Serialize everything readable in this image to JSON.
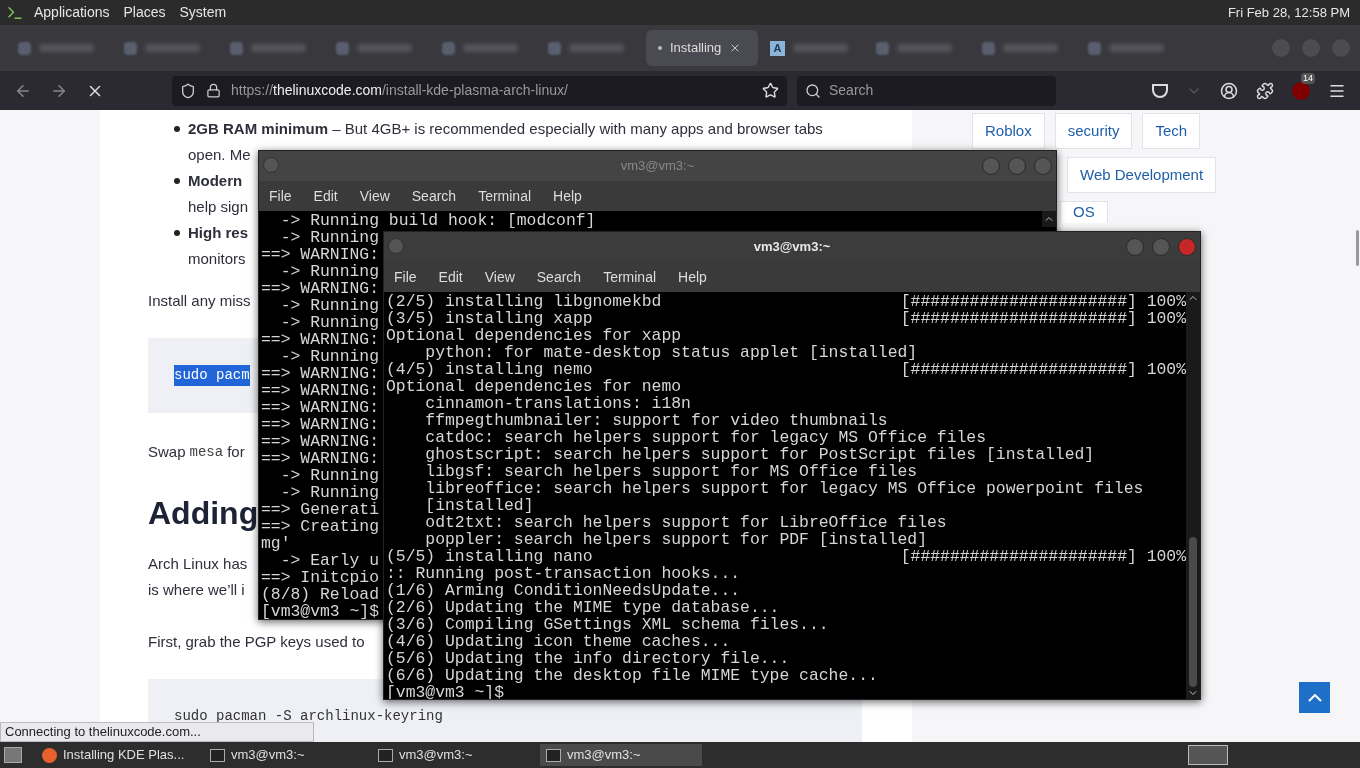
{
  "top_panel": {
    "menus": [
      "Applications",
      "Places",
      "System"
    ],
    "clock": "Fri Feb 28, 12:58 PM"
  },
  "tabs": [
    {
      "kind": "blurred",
      "selected": false
    },
    {
      "kind": "blurred",
      "selected": false
    },
    {
      "kind": "blurred",
      "selected": false
    },
    {
      "kind": "blurred",
      "selected": false
    },
    {
      "kind": "blurred",
      "selected": false
    },
    {
      "kind": "blurred",
      "selected": false
    },
    {
      "kind": "page",
      "label": "Installing",
      "selected": true
    },
    {
      "kind": "blurred",
      "icon_letter": "A",
      "selected": false
    },
    {
      "kind": "blurred",
      "selected": false
    },
    {
      "kind": "blurred",
      "selected": false
    },
    {
      "kind": "blurred",
      "selected": false
    }
  ],
  "address": {
    "scheme": "https://",
    "host": "thelinuxcode.com",
    "path": "/install-kde-plasma-arch-linux/"
  },
  "search": {
    "placeholder": "Search"
  },
  "extension_badge": "14",
  "article": [
    {
      "kind": "bullet",
      "lines": [
        "**2GB RAM minimum** – But 4GB+ is recommended especially with many apps and browser tabs",
        "open. Me"
      ]
    },
    {
      "kind": "bullet",
      "lines": [
        "**Modern**",
        "help sign"
      ]
    },
    {
      "kind": "bullet",
      "lines": [
        "**High res**",
        "monitors"
      ]
    },
    {
      "kind": "paragraph",
      "lines": [
        "Install any miss"
      ]
    },
    {
      "kind": "code",
      "text": "sudo pacm",
      "selected": true
    },
    {
      "kind": "code_mention",
      "before": "Swap",
      "code": "mesa",
      "after": "for"
    },
    {
      "kind": "heading",
      "text": "Adding"
    },
    {
      "kind": "paragraph",
      "lines": [
        "Arch Linux has",
        "is where we’ll i"
      ]
    },
    {
      "kind": "paragraph",
      "lines": [
        "First, grab the PGP keys used to"
      ]
    },
    {
      "kind": "code",
      "text": "sudo pacman -S archlinux-keyring",
      "selected": false
    }
  ],
  "sidebar_tags": [
    [
      "Roblox",
      "security",
      "Tech"
    ],
    [
      "Web Development"
    ],
    [
      "OS"
    ]
  ],
  "status_text": "Connecting to thelinuxcode.com...",
  "terminals": [
    {
      "title": "vm3@vm3:~",
      "active": false,
      "menu": [
        "File",
        "Edit",
        "View",
        "Search",
        "Terminal",
        "Help"
      ],
      "lines": [
        {
          "text": "  -> Running build hook: [modconf]"
        },
        {
          "text": "  -> Running"
        },
        {
          "text": "==> WARNING:"
        },
        {
          "text": "  -> Running"
        },
        {
          "text": "==> WARNING:"
        },
        {
          "text": "  -> Running"
        },
        {
          "text": "  -> Running"
        },
        {
          "text": "==> WARNING:"
        },
        {
          "text": "  -> Running"
        },
        {
          "text": "==> WARNING:"
        },
        {
          "text": "==> WARNING:"
        },
        {
          "text": "==> WARNING:"
        },
        {
          "text": "==> WARNING:"
        },
        {
          "text": "==> WARNING:"
        },
        {
          "text": "==> WARNING:"
        },
        {
          "text": "  -> Running"
        },
        {
          "text": "  -> Running"
        },
        {
          "text": "==> Generati"
        },
        {
          "text": "==> Creating"
        },
        {
          "text": "mg'"
        },
        {
          "text": "  -> Early u"
        },
        {
          "text": "==> Initcpio"
        },
        {
          "text": "(8/8) Reload"
        },
        {
          "text": "[vm3@vm3 ~]$"
        }
      ]
    },
    {
      "title": "vm3@vm3:~",
      "active": true,
      "menu": [
        "File",
        "Edit",
        "View",
        "Search",
        "Terminal",
        "Help"
      ],
      "lines": [
        {
          "text": "(2/5) installing libgnomekbd",
          "progress": "[######################] 100%"
        },
        {
          "text": "(3/5) installing xapp",
          "progress": "[######################] 100%"
        },
        {
          "text": "Optional dependencies for xapp"
        },
        {
          "text": "    python: for mate-desktop status applet [installed]"
        },
        {
          "text": "(4/5) installing nemo",
          "progress": "[######################] 100%"
        },
        {
          "text": "Optional dependencies for nemo"
        },
        {
          "text": "    cinnamon-translations: i18n"
        },
        {
          "text": "    ffmpegthumbnailer: support for video thumbnails"
        },
        {
          "text": "    catdoc: search helpers support for legacy MS Office files"
        },
        {
          "text": "    ghostscript: search helpers support for PostScript files [installed]"
        },
        {
          "text": "    libgsf: search helpers support for MS Office files"
        },
        {
          "text": "    libreoffice: search helpers support for legacy MS Office powerpoint files"
        },
        {
          "text": "    [installed]"
        },
        {
          "text": "    odt2txt: search helpers support for LibreOffice files"
        },
        {
          "text": "    poppler: search helpers support for PDF [installed]"
        },
        {
          "text": "(5/5) installing nano",
          "progress": "[######################] 100%"
        },
        {
          "text": ":: Running post-transaction hooks..."
        },
        {
          "text": "(1/6) Arming ConditionNeedsUpdate..."
        },
        {
          "text": "(2/6) Updating the MIME type database..."
        },
        {
          "text": "(3/6) Compiling GSettings XML schema files..."
        },
        {
          "text": "(4/6) Updating icon theme caches..."
        },
        {
          "text": "(5/6) Updating the info directory file..."
        },
        {
          "text": "(6/6) Updating the desktop file MIME type cache..."
        },
        {
          "text": "[vm3@vm3 ~]$"
        }
      ]
    }
  ],
  "taskbar": [
    {
      "kind": "browser",
      "label": "Installing KDE Plas...",
      "selected": false
    },
    {
      "kind": "terminal",
      "label": "vm3@vm3:~",
      "selected": false
    },
    {
      "kind": "terminal",
      "label": "vm3@vm3:~",
      "selected": false
    },
    {
      "kind": "terminal",
      "label": "vm3@vm3:~",
      "selected": true
    }
  ]
}
